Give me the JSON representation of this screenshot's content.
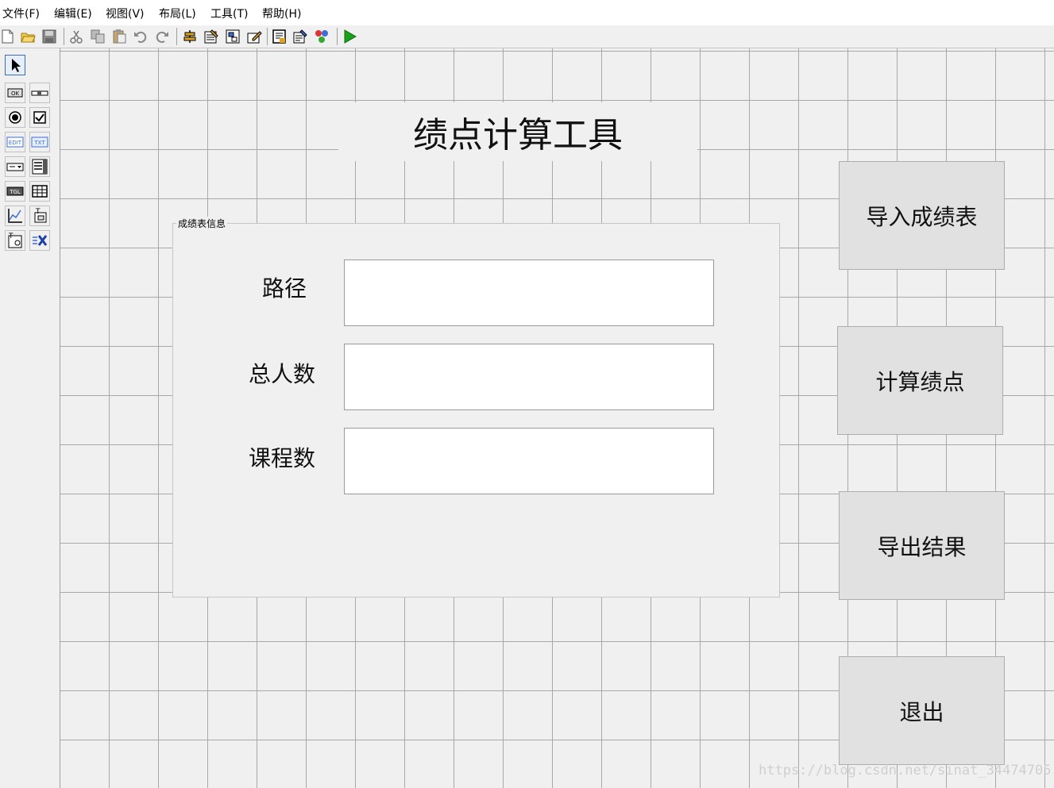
{
  "menu": [
    "文件(F)",
    "编辑(E)",
    "视图(V)",
    "布局(L)",
    "工具(T)",
    "帮助(H)"
  ],
  "toolbar_icons": [
    "new-file-icon",
    "open-folder-icon",
    "save-icon",
    "cut-icon",
    "copy-icon",
    "paste-icon",
    "undo-icon",
    "redo-icon",
    "align-icon",
    "edit-props-icon",
    "tab-order-icon",
    "edit-form-icon",
    "resource-icon",
    "edit-resource-icon",
    "color-icon",
    "run-icon"
  ],
  "palette_icons": [
    "pointer-icon",
    "push-button-icon",
    "slider-icon",
    "radio-button-icon",
    "checkbox-icon",
    "edit-text-icon",
    "static-text-icon",
    "popup-menu-icon",
    "listbox-icon",
    "toggle-button-icon",
    "table-icon",
    "axes-icon",
    "panel-icon",
    "button-group-icon",
    "activex-icon"
  ],
  "form": {
    "title": "绩点计算工具",
    "group_title": "成绩表信息",
    "fields": [
      {
        "label": "路径",
        "value": ""
      },
      {
        "label": "总人数",
        "value": ""
      },
      {
        "label": "课程数",
        "value": ""
      }
    ],
    "buttons": {
      "import": "导入成绩表",
      "calculate": "计算绩点",
      "export": "导出结果",
      "exit": "退出"
    }
  },
  "watermark": "https://blog.csdn.net/sinat_34474705",
  "colors": {
    "run_green": "#1aa01a",
    "canvas_bg": "#f0f0f0",
    "button_bg": "#e1e1e1"
  }
}
